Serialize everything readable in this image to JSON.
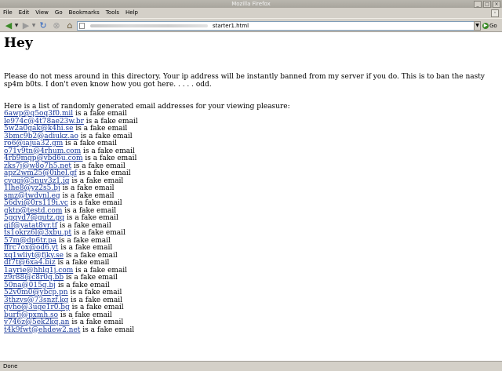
{
  "window": {
    "title": "Mozilla Firefox"
  },
  "menu": [
    "File",
    "Edit",
    "View",
    "Go",
    "Bookmarks",
    "Tools",
    "Help"
  ],
  "nav": {
    "url_visible": "starter1.html",
    "go_label": "Go",
    "icons": [
      "back-arrow",
      "forward-arrow",
      "reload",
      "stop",
      "home"
    ]
  },
  "page": {
    "heading": "Hey",
    "warning": "Please do not mess around in this directory. Your ip address will be instantly banned from my server if you do. This is to ban the nasty sp4m b0ts. I don't even know how you got here. . . . . odd.",
    "intro": "Here is a list of randomly generated email addresses for your viewing pleasure:",
    "suffix": " is a fake email",
    "emails": [
      "6awp@q5oq3f0.mil",
      "le974c@4t78ae23w.br",
      "5w2a0gak@k4hi.se",
      "3bmc9b2@adiukz.ao",
      "ro6@iajua32.gm",
      "o71v9tn@4rhum.com",
      "4rb9mqp@vbd6u.com",
      "zks7j@w8o7h5.net",
      "apz2wm25@0ihel.gf",
      "cvgqj@5nuv3z1.iq",
      "1lhe8@yz2s5.bj",
      "smz@twdvnl.eg",
      "56dvi@0rs119i.vc",
      "gktp@testd.com",
      "5gqyd7@gutz.gq",
      "qif@yatat8vr.tf",
      "ts1okrz6l@3xbu.pt",
      "57m@dp6tr.pa",
      "ffrc7ox@od6.yt",
      "xq1wliyt@fjky.se",
      "df7t@6xa4.biz",
      "1ayrie@hhlg1j.com",
      "z9r88@c8r0q.bb",
      "50na@015g.bj",
      "52v0m0@ybcp.pn",
      "3thzvs@73snzf.kg",
      "qvho@3uge1r0.bg",
      "burfj@pxmh.so",
      "v746z@5ek2kq.an",
      "t4k9fwt@ehdew2.net"
    ]
  },
  "status": {
    "text": "Done"
  }
}
